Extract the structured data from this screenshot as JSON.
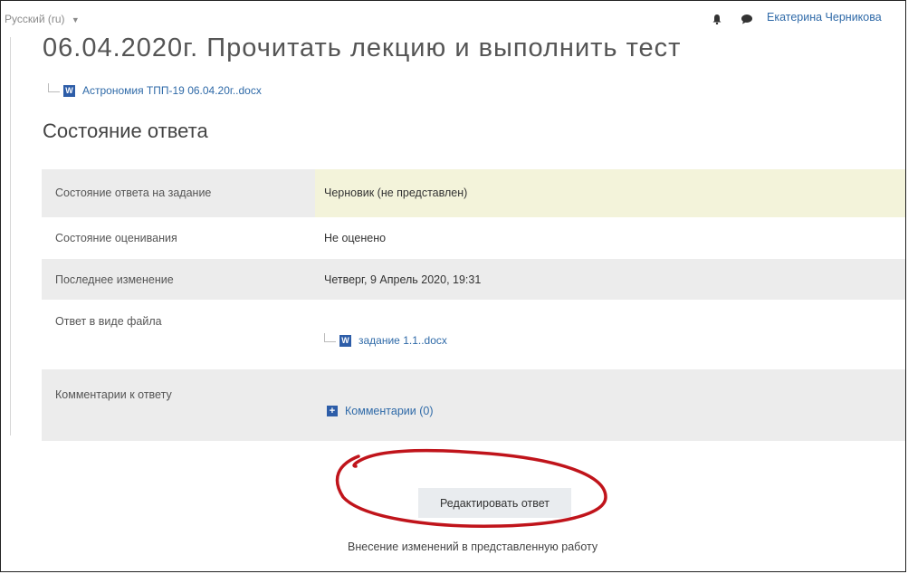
{
  "header": {
    "language": "Русский (ru)",
    "language_caret": "▼",
    "user_name": "Екатерина Черникова"
  },
  "page": {
    "heading_partial": "06.04.2020г. Прочитать лекцию и выполнить тест",
    "attachment": "Астрономия ТПП-19 06.04.20г..docx",
    "section_title": "Состояние ответа"
  },
  "status_table": [
    {
      "label": "Состояние ответа на задание",
      "value": "Черновик (не представлен)"
    },
    {
      "label": "Состояние оценивания",
      "value": "Не оценено"
    },
    {
      "label": "Последнее изменение",
      "value": "Четверг, 9 Апрель 2020, 19:31"
    },
    {
      "label": "Ответ в виде файла",
      "file": "задание 1.1..docx"
    },
    {
      "label": "Комментарии к ответу",
      "comments_link": "Комментарии (0)"
    }
  ],
  "actions": {
    "edit_button": "Редактировать ответ",
    "edit_note": "Внесение изменений в представленную работу"
  },
  "icons": {
    "word_letter": "W",
    "plus_symbol": "+"
  },
  "colors": {
    "link": "#2f6aa8",
    "draft_highlight": "#f3f3da",
    "row_shade": "#ececec",
    "annotation": "#c0141b"
  }
}
